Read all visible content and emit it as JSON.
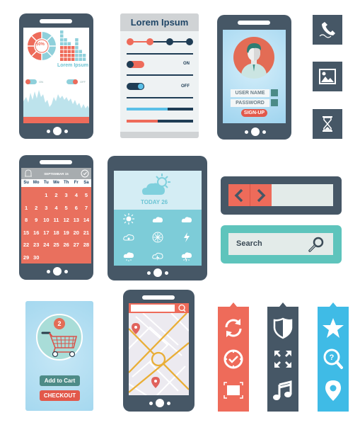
{
  "colors": {
    "dark": "#465766",
    "coral": "#ee6b5a",
    "teal": "#8fd0db",
    "navy": "#1f4566",
    "sky": "#3fbbe6",
    "mint": "#5ec4bc",
    "grey_light": "#e8eef0"
  },
  "dashboard_phone": {
    "donut_label": "50%",
    "title": "Lorem Ipsum",
    "toggle_on_label": "ON",
    "toggle_off_label": "OFF",
    "icon": "analytics-dashboard"
  },
  "settings_panel": {
    "title": "Lorem Ipsum",
    "toggle1_label": "ON",
    "toggle2_label": "OFF",
    "slider_stops": 4,
    "slider_active_stops": 2,
    "progress_blue": 0.62,
    "progress_red": 0.47
  },
  "login_phone": {
    "username_label": "USER NAME",
    "password_label": "PASSWORD",
    "signup_label": "SIGN-UP",
    "avatar": "user-avatar"
  },
  "square_icons": [
    {
      "name": "phone-icon"
    },
    {
      "name": "image-icon"
    },
    {
      "name": "hourglass-icon"
    }
  ],
  "calendar_phone": {
    "header": "SEPTEMBAR 15",
    "weekdays": [
      "Su",
      "Mo",
      "Tu",
      "We",
      "Th",
      "Fr",
      "Sa"
    ],
    "days": [
      "",
      "",
      "1",
      "2",
      "3",
      "4",
      "5",
      "1",
      "2",
      "3",
      "4",
      "5",
      "6",
      "7",
      "8",
      "9",
      "10",
      "11",
      "12",
      "13",
      "14",
      "15",
      "16",
      "17",
      "18",
      "19",
      "20",
      "21",
      "22",
      "23",
      "24",
      "25",
      "26",
      "27",
      "28",
      "29",
      "30",
      "",
      "",
      "",
      "",
      ""
    ]
  },
  "weather_tablet": {
    "today_label": "TODAY 26",
    "icons": [
      "sun-icon",
      "partly-cloudy-icon",
      "cloud-icon",
      "snow-cloud-icon",
      "snowflake-icon",
      "lightning-icon",
      "rain-icon",
      "thunderstorm-icon",
      "storm-icon"
    ]
  },
  "nav_bar": {
    "prev_icon": "chevron-left-icon",
    "next_icon": "chevron-right-icon"
  },
  "search_bar": {
    "placeholder": "Search",
    "icon": "search-icon"
  },
  "cart_card": {
    "badge_count": "2",
    "add_label": "Add to Cart",
    "checkout_label": "CHECKOUT"
  },
  "map_phone": {
    "search_icon": "map-search-icon",
    "pins": 2
  },
  "ribbons": [
    {
      "color": "#ee6b5a",
      "icons": [
        "refresh-icon",
        "clock-check-icon",
        "fullscreen-frame-icon"
      ]
    },
    {
      "color": "#465766",
      "icons": [
        "shield-icon",
        "expand-arrows-icon",
        "music-icon"
      ]
    },
    {
      "color": "#3fbbe6",
      "icons": [
        "star-icon",
        "search-help-icon",
        "location-pin-icon"
      ]
    }
  ]
}
